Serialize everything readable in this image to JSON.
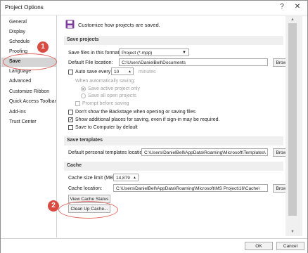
{
  "window": {
    "title": "Project Options",
    "help_glyph": "?",
    "close_glyph": "✕"
  },
  "sidebar": {
    "items": [
      {
        "label": "General"
      },
      {
        "label": "Display"
      },
      {
        "label": "Schedule"
      },
      {
        "label": "Proofing"
      },
      {
        "label": "Save",
        "selected": true
      },
      {
        "label": "Language"
      },
      {
        "label": "Advanced"
      },
      {
        "label": "Customize Ribbon"
      },
      {
        "label": "Quick Access Toolbar"
      },
      {
        "label": "Add-ins"
      },
      {
        "label": "Trust Center"
      }
    ]
  },
  "callouts": {
    "one": "1",
    "two": "2"
  },
  "header": {
    "text": "Customize how projects are saved.",
    "icon": "floppy-disk-icon"
  },
  "save_projects": {
    "section": "Save projects",
    "format_label": "Save files in this format:",
    "format_value": "Project (*.mpp)",
    "location_label": "Default File location:",
    "location_value": "C:\\Users\\DanielBell\\Documents",
    "browse": "Browse...",
    "autosave_label": "Auto save every",
    "autosave_value": "10",
    "minutes": "minutes",
    "when_label": "When automatically saving:",
    "radio_active": "Save active project only",
    "radio_all": "Save all open projects",
    "prompt": "Prompt before saving",
    "backstage": "Don't show the Backstage when opening or saving files",
    "additional": "Show additional places for saving, even if sign-in may be required.",
    "computer": "Save to Computer by default"
  },
  "save_templates": {
    "section": "Save templates",
    "label": "Default personal templates location:",
    "value": "C:\\Users\\DanielBell\\AppData\\Roaming\\Microsoft\\Templates\\",
    "browse": "Browse..."
  },
  "cache": {
    "section": "Cache",
    "size_label": "Cache size limit (MB):",
    "size_value": "14,879",
    "location_label": "Cache location:",
    "location_value": "C:\\Users\\DanielBell\\AppData\\Roaming\\Microsoft\\MS Project\\16\\Cache\\",
    "browse": "Browse...",
    "view_status": "View Cache Status",
    "clean_up": "Clean Up Cache..."
  },
  "footer": {
    "ok": "OK",
    "cancel": "Cancel"
  },
  "colors": {
    "accent": "#7a3a9a",
    "callout": "#d94a41"
  }
}
